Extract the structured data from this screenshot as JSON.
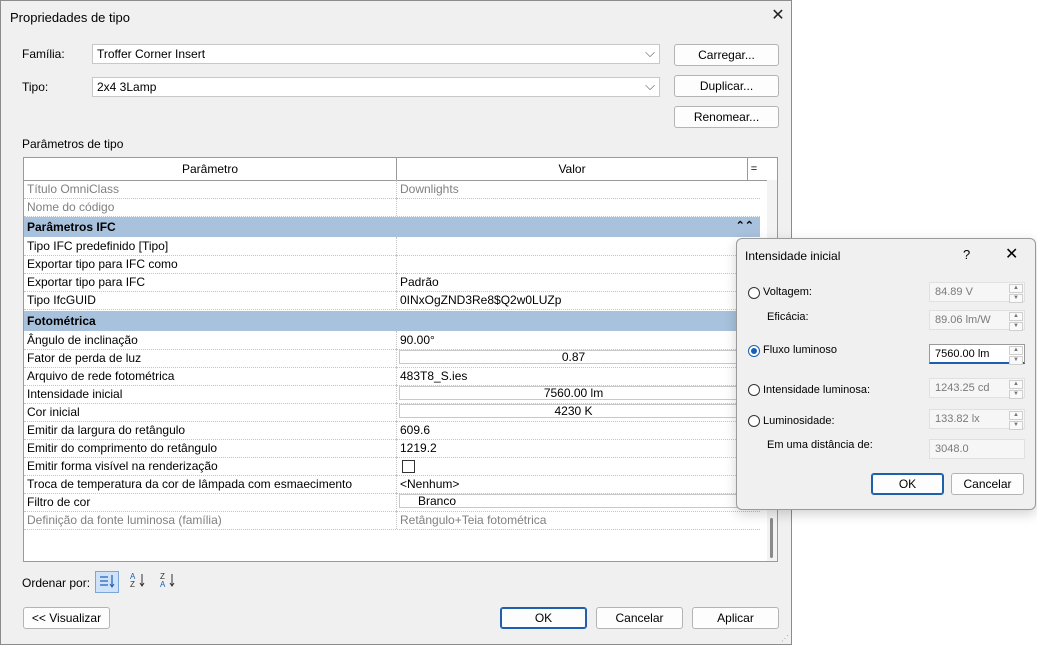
{
  "dialog": {
    "title": "Propriedades de tipo",
    "family_label": "Família:",
    "family_value": "Troffer Corner Insert",
    "type_label": "Tipo:",
    "type_value": "2x4 3Lamp",
    "load_button": "Carregar...",
    "duplicate_button": "Duplicar...",
    "rename_button": "Renomear...",
    "params_label": "Parâmetros de tipo",
    "sort_label": "Ordenar por:",
    "preview_button": "<< Visualizar",
    "ok_button": "OK",
    "cancel_button": "Cancelar",
    "apply_button": "Aplicar"
  },
  "grid": {
    "col_param": "Parâmetro",
    "col_value": "Valor",
    "col_toggle": "=",
    "rows_top": [
      {
        "param": "Título OmniClass",
        "value": "Downlights"
      },
      {
        "param": "Nome do código",
        "value": ""
      }
    ],
    "group_ifc": "Parâmetros IFC",
    "rows_ifc": [
      {
        "param": "Tipo IFC predefinido [Tipo]",
        "value": ""
      },
      {
        "param": "Exportar tipo para IFC como",
        "value": ""
      },
      {
        "param": "Exportar tipo para IFC",
        "value": "Padrão"
      },
      {
        "param": "Tipo IfcGUID",
        "value": "0INxOgZND3Re8$Q2w0LUZp"
      }
    ],
    "group_photo": "Fotométrica",
    "rows_photo": [
      {
        "param": "Ângulo de inclinação",
        "value": "90.00°"
      },
      {
        "param": "Fator de perda de luz",
        "value": "0.87"
      },
      {
        "param": "Arquivo de rede fotométrica",
        "value": "483T8_S.ies"
      },
      {
        "param": "Intensidade inicial",
        "value": "7560.00 lm"
      },
      {
        "param": "Cor inicial",
        "value": "4230 K"
      },
      {
        "param": "Emitir da largura do retângulo",
        "value": "609.6"
      },
      {
        "param": "Emitir do comprimento do retângulo",
        "value": "1219.2"
      },
      {
        "param": "Emitir forma visível na renderização",
        "value": ""
      },
      {
        "param": "Troca de temperatura da cor de lâmpada com esmaecimento",
        "value": "<Nenhum>"
      },
      {
        "param": "Filtro de cor",
        "value": "Branco"
      },
      {
        "param": "Definição da fonte luminosa (família)",
        "value": "Retângulo+Teia fotométrica"
      }
    ]
  },
  "sub": {
    "title": "Intensidade inicial",
    "help": "?",
    "voltage_label": "Voltagem:",
    "voltage_value": "84.89 V",
    "efficacy_label": "Eficácia:",
    "efficacy_value": "89.06 lm/W",
    "flux_label": "Fluxo luminoso",
    "flux_value": "7560.00 lm",
    "intensity_label": "Intensidade luminosa:",
    "intensity_value": "1243.25 cd",
    "illuminance_label": "Luminosidade:",
    "illuminance_value": "133.82 lx",
    "distance_label": "Em uma distância de:",
    "distance_value": "3048.0",
    "ok_button": "OK",
    "cancel_button": "Cancelar"
  }
}
